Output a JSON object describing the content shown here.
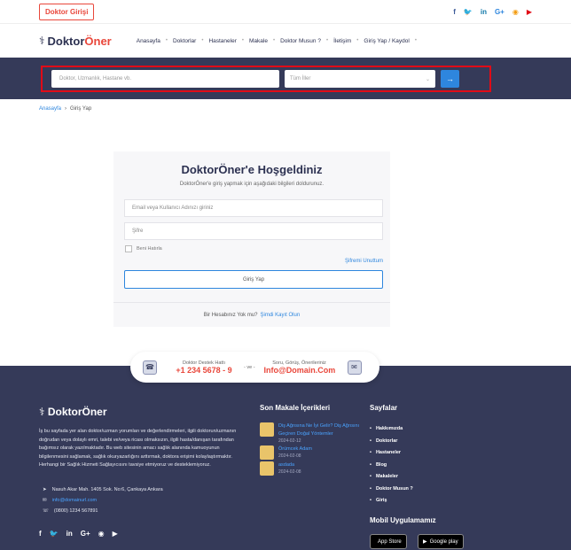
{
  "topbar": {
    "login_label": "Doktor Girişi",
    "social_icons": [
      "facebook-icon",
      "twitter-icon",
      "linkedin-icon",
      "google-plus-icon",
      "rss-icon",
      "youtube-icon"
    ]
  },
  "brand": {
    "logo_prefix": "Doktor",
    "logo_suffix": "Öner"
  },
  "nav": {
    "items": [
      "Anasayfa",
      "Doktorlar",
      "Hastaneler",
      "Makale",
      "Doktor Musun ?",
      "İletişim",
      "Giriş Yap / Kaydol"
    ]
  },
  "search": {
    "placeholder": "Doktor, Uzmanlık, Hastane vb.",
    "city_selected": "Tüm İller",
    "button_icon": "arrow-right-icon"
  },
  "breadcrumb": {
    "home": "Anasayfa",
    "current": "Giriş Yap"
  },
  "login": {
    "title": "DoktorÖner'e Hoşgeldiniz",
    "subtitle": "DoktorÖner'e giriş yapmak için aşağıdaki bilgileri doldurunuz.",
    "email_placeholder": "Email veya Kullanıcı Adınızı giriniz",
    "password_placeholder": "Şifre",
    "remember_label": "Beni Hatırla",
    "forgot_label": "Şifremi Unuttum",
    "submit_label": "Giriş Yap",
    "no_account_text": "Bir Hesabınız Yok mu?",
    "register_link": "Şimdi Kayıt Olun"
  },
  "support": {
    "line_label": "Doktor Destek Hattı",
    "phone": "+1 234 5678 - 9",
    "separator": "- ve -",
    "mail_label": "Soru, Görüş, Önerileriniz",
    "email": "Info@Domain.Com"
  },
  "footer": {
    "description": "İş bu sayfada yer alan doktor/uzman yorumları ve değerlendirmeleri, ilgili doktorun/uzmanın doğrudan veya dolaylı emri, talebi ve/veya ricası olmaksızın, ilgili hasta/danışan tarafından bağımsız olarak yazılmaktadır. Bu web sitesinin amacı sağlık alanında kamuoyunun bilgilenmesini sağlamak, sağlık okuryazarlığını arttırmak, doktora erişimi kolaylaştırmaktır. Herhangi bir Sağlık Hizmeti Sağlayıcısını tavsiye etmiyoruz ve desteklemiyoruz.",
    "address": "Nasuh Akar Mah. 1405 Sok. No:6, Çankaya Ankara",
    "email": "info@domainurl.com",
    "phone": "(0800) 1234 567891",
    "articles_title": "Son Makale İçerikleri",
    "articles": [
      {
        "title": "Diş Ağrısına Ne İyi Gelir? Diş Ağrısını Geçiren Doğal Yöntemler",
        "date": "2024-02-12"
      },
      {
        "title": "Örümcek Adam",
        "date": "2024-02-08"
      },
      {
        "title": "asdada",
        "date": "2024-02-08"
      }
    ],
    "pages_title": "Sayfalar",
    "pages": [
      "Hakkımızda",
      "Doktorlar",
      "Hastaneler",
      "Blog",
      "Makaleler",
      "Doktor Musun ?",
      "Giriş"
    ],
    "mobile_title": "Mobil Uygulamamız",
    "app_store": "App Store",
    "google_play": "Google play"
  },
  "colors": {
    "accent": "#e9473b",
    "dark": "#353a59",
    "link": "#2e86de",
    "highlight": "#e10b17"
  }
}
